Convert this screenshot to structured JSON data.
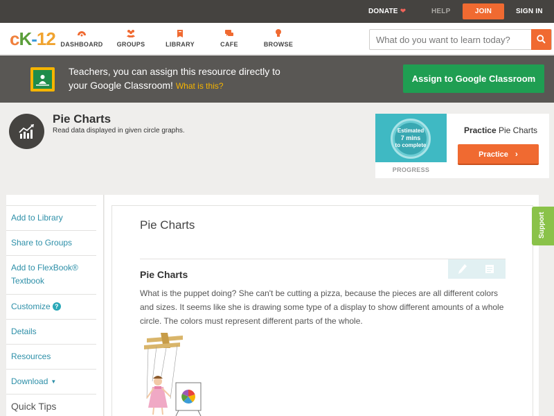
{
  "topbar": {
    "donate": "DONATE",
    "help": "HELP",
    "join": "JOIN",
    "signin": "SIGN IN"
  },
  "nav": {
    "dashboard": "DASHBOARD",
    "groups": "GROUPS",
    "library": "LIBRARY",
    "cafe": "CAFE",
    "browse": "BROWSE"
  },
  "search": {
    "placeholder": "What do you want to learn today?"
  },
  "banner": {
    "line1": "Teachers, you can assign this resource directly to",
    "line2": "your Google Classroom!",
    "what": "What is this?",
    "button": "Assign to Google Classroom"
  },
  "header": {
    "title": "Pie Charts",
    "subtitle": "Read data displayed in given circle graphs."
  },
  "practice": {
    "estimated_l1": "Estimated",
    "estimated_l2": "7 mins",
    "estimated_l3": "to complete",
    "progress": "PROGRESS",
    "heading_bold": "Practice",
    "heading_rest": "Pie Charts",
    "button": "Practice"
  },
  "sidebar": {
    "items": [
      "Add to Library",
      "Share to Groups",
      "Add to FlexBook® Textbook",
      "Customize",
      "Details",
      "Resources",
      "Download",
      "Quick Tips"
    ]
  },
  "article": {
    "title": "Pie Charts",
    "section_title": "Pie Charts",
    "body": "What is the puppet doing? She can't be cutting a pizza, because the pieces are all different colors and sizes. It seems like she is drawing some type of a display to show different amounts of a whole circle. The colors must represent different parts of the whole."
  },
  "support": "Support",
  "colors": {
    "accent_orange": "#f06a31",
    "google_green": "#1f9e52",
    "link_teal": "#2d8fa8",
    "support_green": "#8ac249"
  }
}
